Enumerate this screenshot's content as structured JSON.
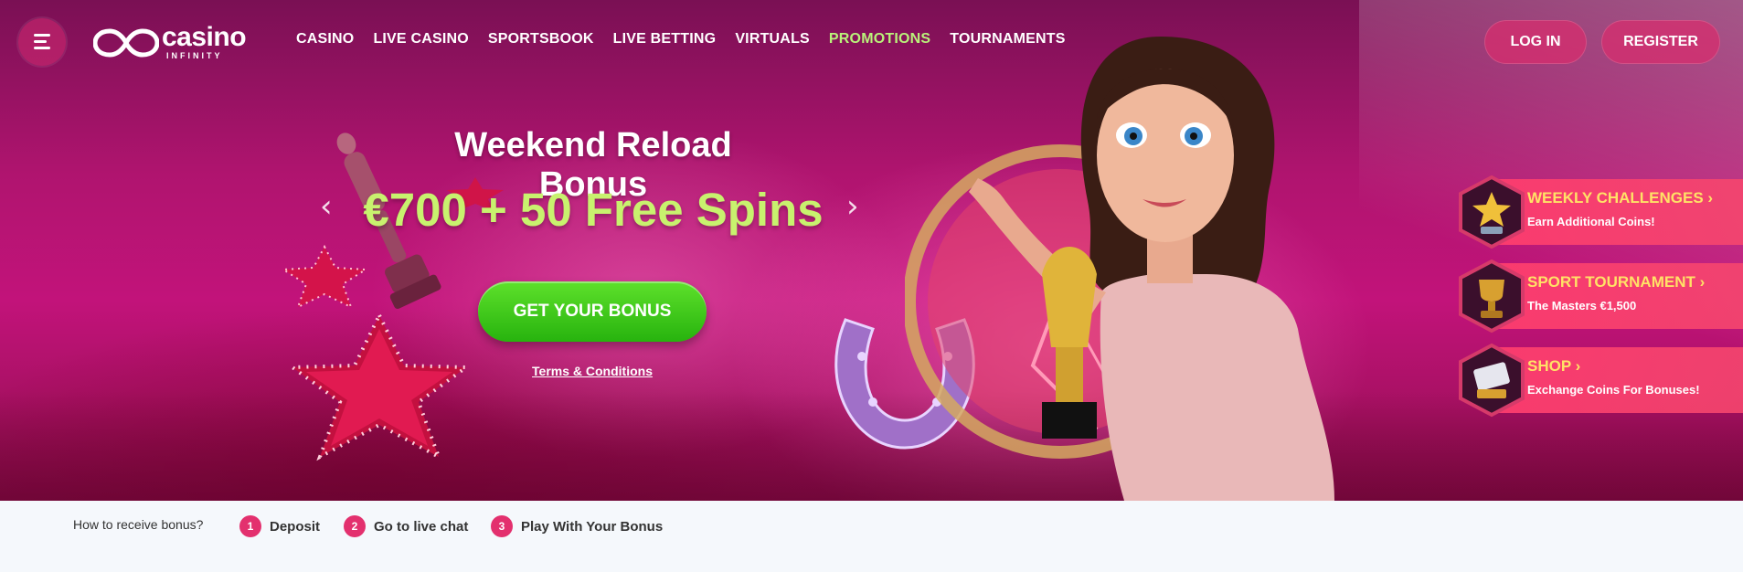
{
  "header": {
    "logo_word": "casino",
    "logo_sub": "INFINITY",
    "nav": [
      {
        "label": "CASINO"
      },
      {
        "label": "LIVE CASINO"
      },
      {
        "label": "SPORTSBOOK"
      },
      {
        "label": "LIVE BETTING"
      },
      {
        "label": "VIRTUALS"
      },
      {
        "label": "PROMOTIONS",
        "active": true
      },
      {
        "label": "TOURNAMENTS"
      }
    ],
    "login_label": "LOG IN",
    "register_label": "REGISTER"
  },
  "promo": {
    "title": "Weekend Reload Bonus",
    "amount": "€700 + 50 Free Spins",
    "cta_label": "GET YOUR BONUS",
    "terms_label": "Terms & Conditions",
    "prev_arrow": "‹",
    "next_arrow": "›"
  },
  "side_cards": [
    {
      "title": "WEEKLY CHALLENGES ›",
      "subtitle": "Earn Additional Coins!",
      "icon": "star-trophy-icon"
    },
    {
      "title": "SPORT TOURNAMENT ›",
      "subtitle": "The Masters €1,500",
      "icon": "trophy-cup-icon"
    },
    {
      "title": "SHOP ›",
      "subtitle": "Exchange Coins For Bonuses!",
      "icon": "card-icon"
    }
  ],
  "steps": {
    "label": "How to receive bonus?",
    "items": [
      {
        "num": "1",
        "text": "Deposit"
      },
      {
        "num": "2",
        "text": "Go to live chat"
      },
      {
        "num": "3",
        "text": "Play With Your Bonus"
      }
    ]
  },
  "colors": {
    "accent_green": "#c8f26e",
    "cta_green": "#3cc51c",
    "pink": "#e3306e",
    "card_title": "#ffe266"
  }
}
